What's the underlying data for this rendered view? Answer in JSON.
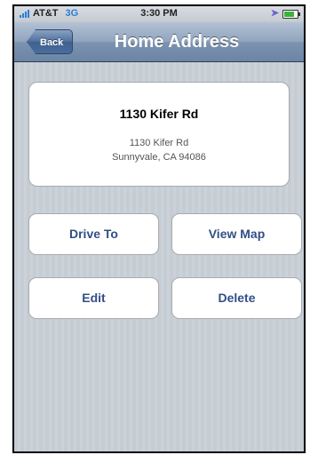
{
  "status_bar": {
    "carrier": "AT&T",
    "network": "3G",
    "time": "3:30 PM",
    "icons": [
      "signal-icon",
      "location-icon",
      "battery-icon"
    ]
  },
  "nav": {
    "back_label": "Back",
    "title": "Home Address"
  },
  "address": {
    "name": "1130 Kifer Rd",
    "line1": "1130 Kifer Rd",
    "line2": "Sunnyvale, CA 94086"
  },
  "actions": {
    "drive_to": "Drive To",
    "view_map": "View Map",
    "edit": "Edit",
    "delete": "Delete"
  },
  "colors": {
    "nav_bar": "#6c85a5",
    "button_text": "#324f85",
    "background": "#c5ccd4"
  }
}
